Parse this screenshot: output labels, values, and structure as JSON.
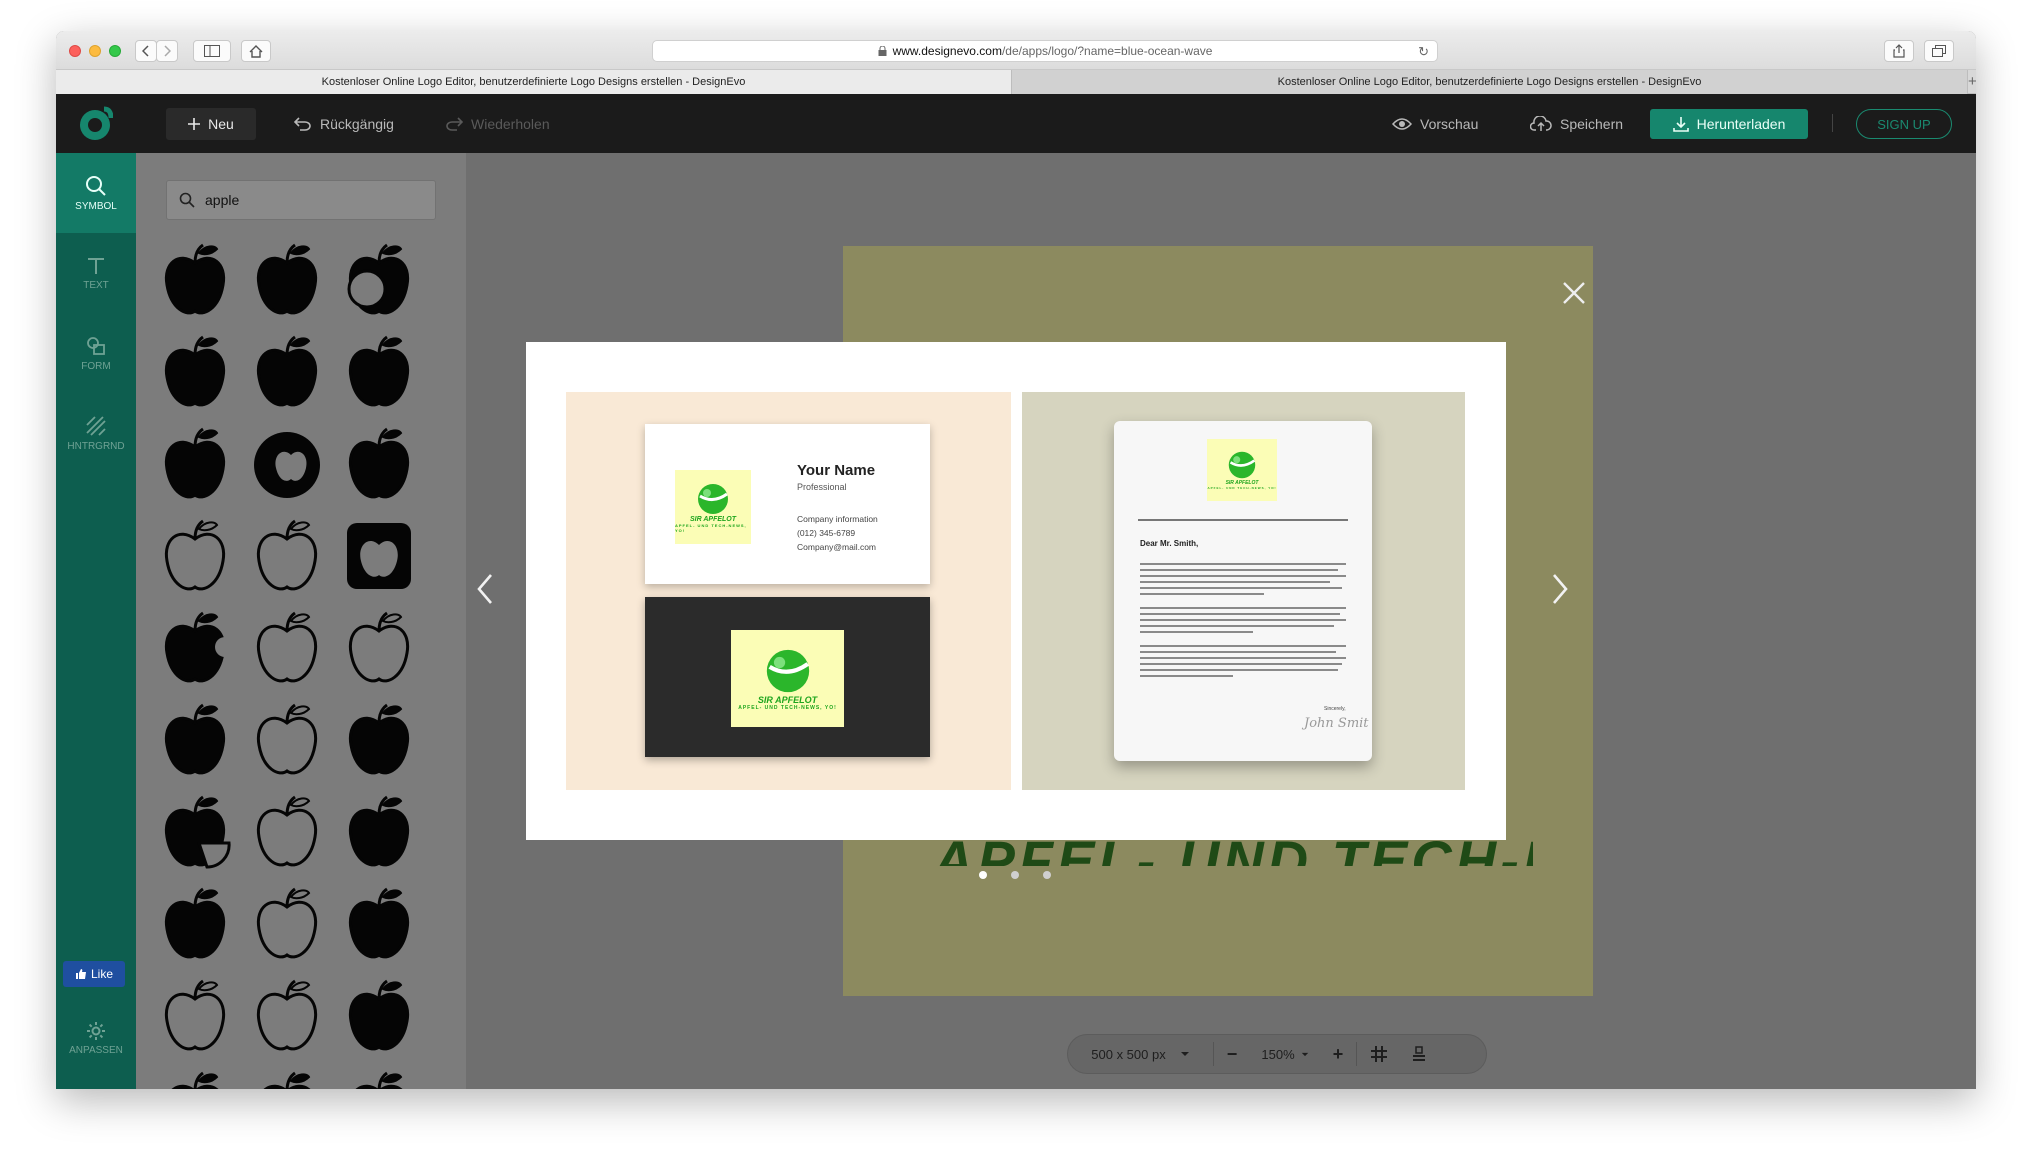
{
  "browser": {
    "url_domain": "www.designevo.com",
    "url_path": "/de/apps/logo/?name=blue-ocean-wave",
    "tabs": [
      {
        "title": "Kostenloser Online Logo Editor, benutzerdefinierte Logo Designs erstellen - DesignEvo",
        "active": true
      },
      {
        "title": "Kostenloser Online Logo Editor, benutzerdefinierte Logo Designs erstellen - DesignEvo",
        "active": false
      }
    ],
    "new_tab_label": "+"
  },
  "toolbar": {
    "new_label": "Neu",
    "undo_label": "Rückgängig",
    "redo_label": "Wiederholen",
    "preview_label": "Vorschau",
    "save_label": "Speichern",
    "download_label": "Herunterladen",
    "signup_label": "SIGN UP"
  },
  "rail": {
    "items": [
      {
        "label": "SYMBOL",
        "icon": "search-icon",
        "active": true
      },
      {
        "label": "TEXT",
        "icon": "text-icon",
        "active": false
      },
      {
        "label": "FORM",
        "icon": "shapes-icon",
        "active": false
      },
      {
        "label": "HNTRGRND",
        "icon": "background-icon",
        "active": false
      }
    ],
    "like_label": "Like",
    "customize_label": "ANPASSEN"
  },
  "panel": {
    "search_value": "apple",
    "search_icon": "search-icon"
  },
  "canvas": {
    "background_color": "#8c8a5f",
    "visible_text": "APFEL- UND TECH-NEWS, YO!"
  },
  "zoombar": {
    "canvas_size": "500 x 500 px",
    "zoom_level": "150%",
    "minus": "−",
    "plus": "+"
  },
  "modal": {
    "slides_total": 3,
    "active_slide": 1,
    "business_card": {
      "name": "Your Name",
      "profession": "Professional",
      "company_info": "Company information",
      "phone": "(012) 345-6789",
      "email": "Company@mail.com",
      "logo_title": "SIR APFELOT",
      "logo_subtitle": "APFEL- UND TECH-NEWS, YO!"
    },
    "letterhead": {
      "greeting": "Dear Mr. Smith,",
      "closing": "Sincerely,",
      "signature": "John Smit",
      "logo_title": "SIR APFELOT",
      "logo_subtitle": "APFEL- UND TECH-NEWS, YO!"
    }
  },
  "colors": {
    "accent": "#16866d",
    "rail": "#0d5e4f",
    "logo_green": "#1da51d",
    "logo_bg": "#fbfdb6"
  }
}
